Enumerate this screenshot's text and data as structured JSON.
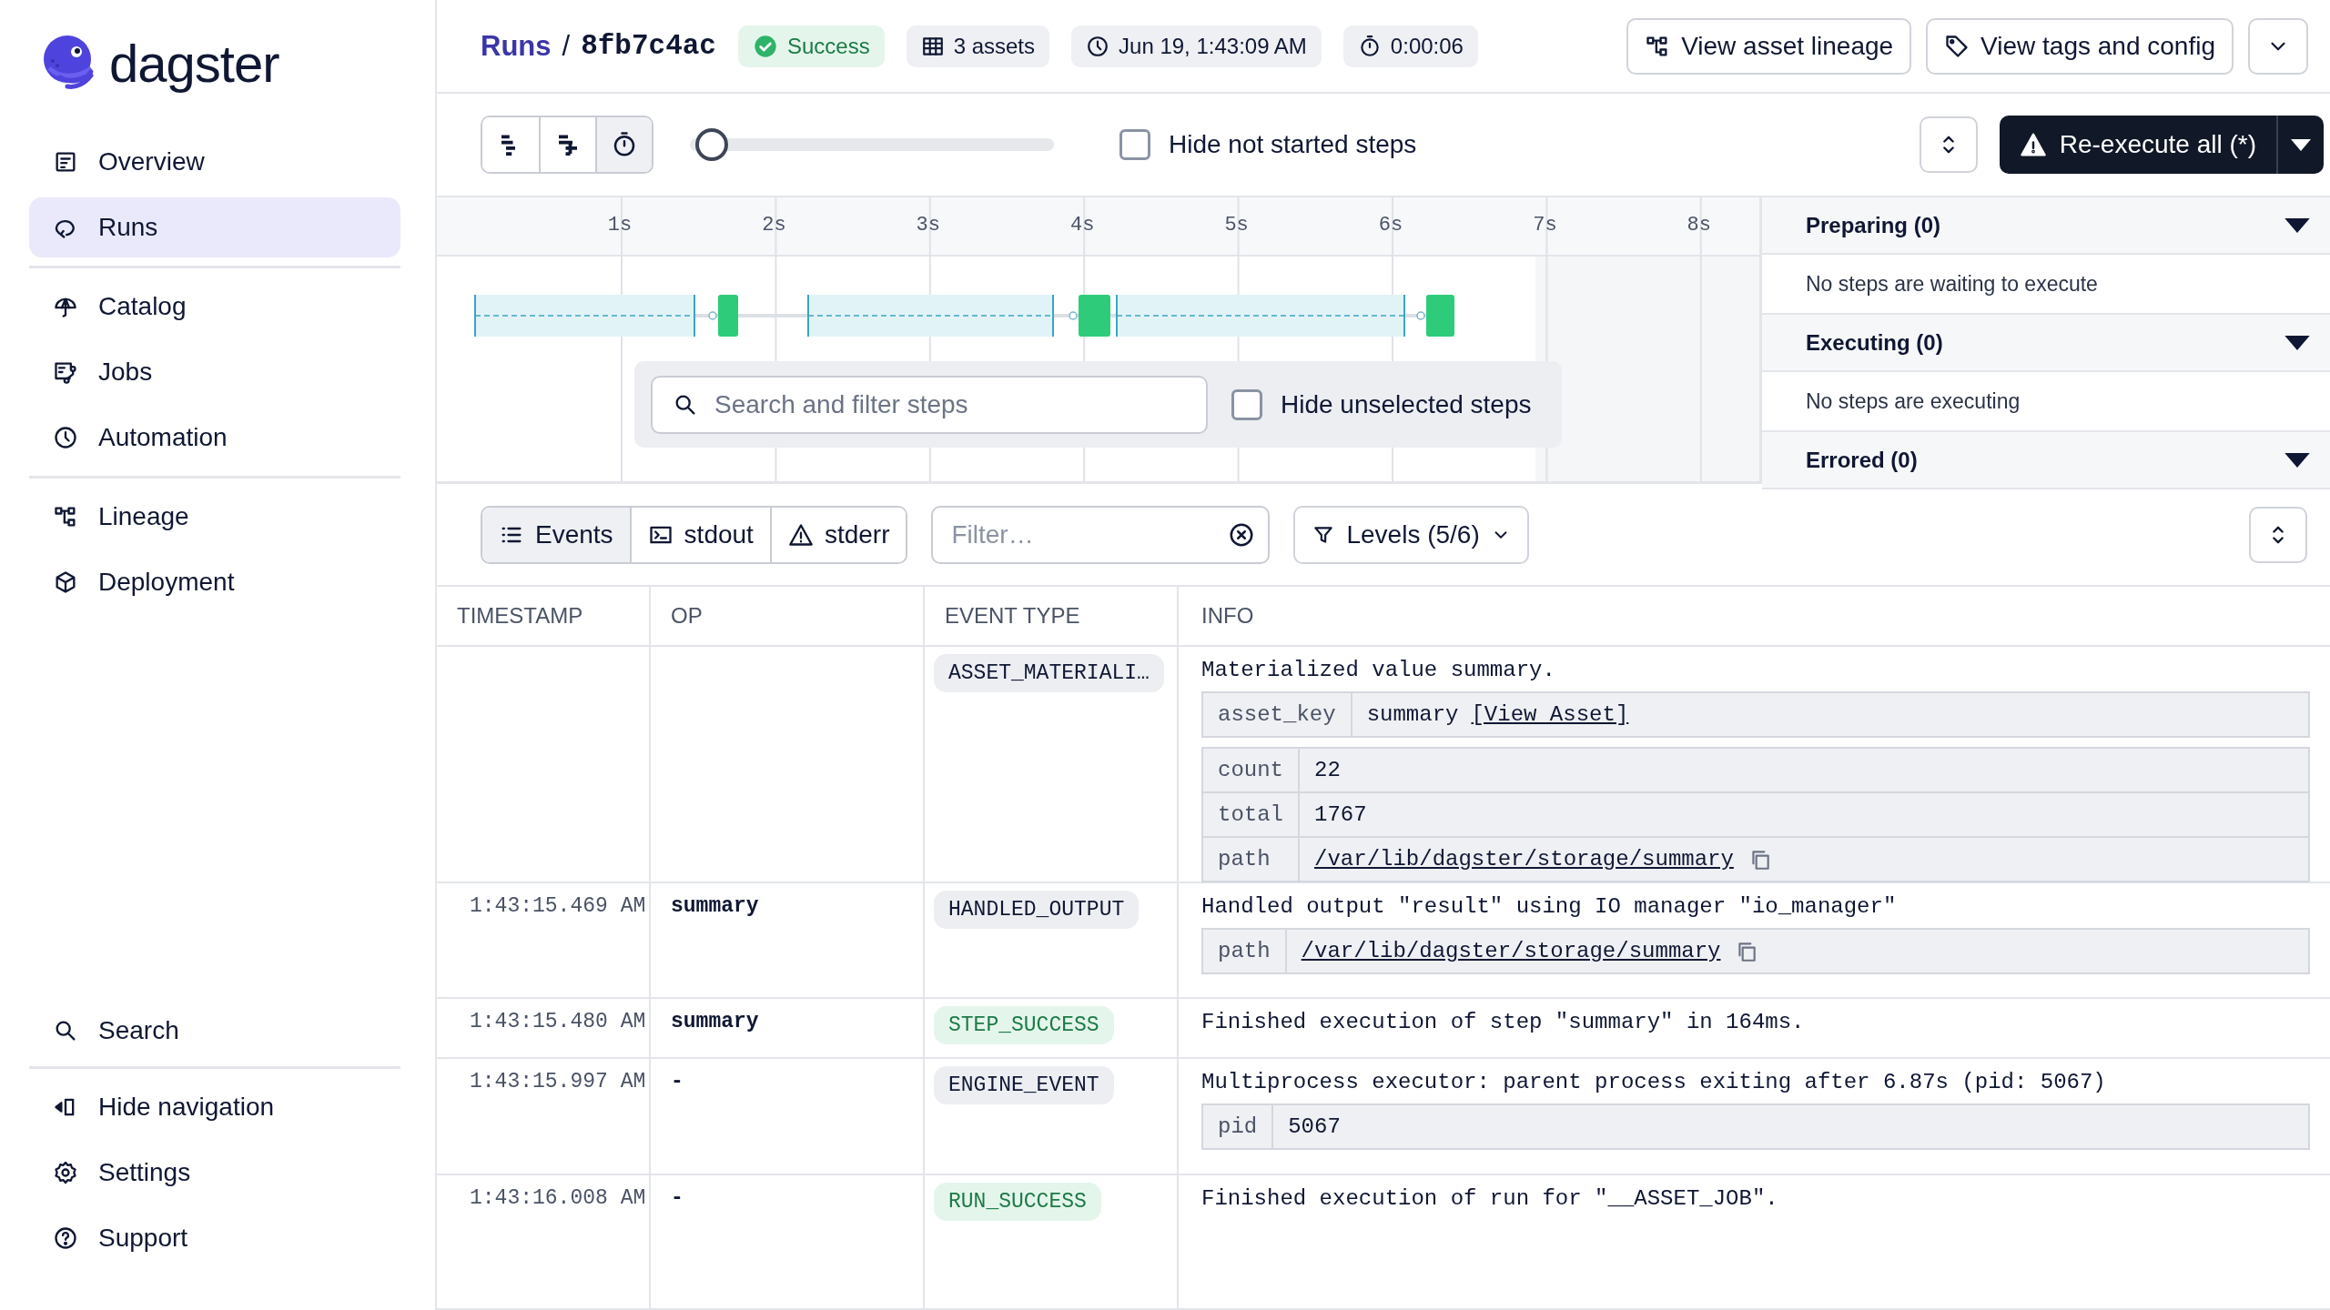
{
  "sidebar": {
    "logo": "dagster",
    "nav_groups": [
      [
        {
          "label": "Overview",
          "selected": false
        },
        {
          "label": "Runs",
          "selected": true
        }
      ],
      [
        {
          "label": "Catalog",
          "selected": false
        },
        {
          "label": "Jobs",
          "selected": false
        },
        {
          "label": "Automation",
          "selected": false
        }
      ],
      [
        {
          "label": "Lineage",
          "selected": false
        },
        {
          "label": "Deployment",
          "selected": false
        }
      ]
    ],
    "footer_groups": [
      [
        {
          "label": "Search"
        }
      ],
      [
        {
          "label": "Hide navigation"
        },
        {
          "label": "Settings"
        },
        {
          "label": "Support"
        }
      ]
    ]
  },
  "header": {
    "breadcrumb": {
      "parent": "Runs",
      "separator": "/",
      "run_id": "8fb7c4ac"
    },
    "status": {
      "label": "Success",
      "kind": "success"
    },
    "tags": [
      "3 assets",
      "Jun 19, 1:43:09 AM",
      "0:00:06"
    ],
    "buttons": [
      "View asset lineage",
      "View tags and config"
    ]
  },
  "toolbar": {
    "view_modes": [
      {
        "selected": false
      },
      {
        "selected": false
      },
      {
        "selected": true
      }
    ],
    "zoom_slider": {
      "level": 0.03
    },
    "hide_not_started": {
      "label": "Hide not started steps",
      "checked": false
    },
    "reexecute": {
      "label": "Re-execute all (*)"
    }
  },
  "timeline": {
    "axis_ticks": [
      "1s",
      "2s",
      "3s",
      "4s",
      "5s",
      "6s",
      "7s",
      "8s"
    ],
    "step_search": {
      "placeholder": "Search and filter steps"
    },
    "hide_unselected": {
      "label": "Hide unselected steps",
      "checked": false
    }
  },
  "status_panel": {
    "sections": [
      {
        "title": "Preparing (0)",
        "message": "No steps are waiting to execute"
      },
      {
        "title": "Executing (0)",
        "message": "No steps are executing"
      },
      {
        "title": "Errored (0)"
      }
    ]
  },
  "logs": {
    "tabs": [
      {
        "label": "Events",
        "selected": true
      },
      {
        "label": "stdout",
        "selected": false
      },
      {
        "label": "stderr",
        "selected": false
      }
    ],
    "filter": {
      "placeholder": "Filter…"
    },
    "levels": {
      "label": "Levels (5/6)"
    },
    "table": {
      "columns": [
        "TIMESTAMP",
        "OP",
        "EVENT TYPE",
        "INFO"
      ],
      "rows": [
        {
          "event_type": "ASSET_MATERIALI…",
          "kind": "neutral",
          "message": "Materialized value summary.",
          "metadata": [
            [
              {
                "key": "asset_key",
                "value": "summary",
                "link": "[View Asset]",
                "kind": "asset"
              }
            ],
            [
              {
                "key": "count",
                "value": "22",
                "kind": "text"
              },
              {
                "key": "total",
                "value": "1767",
                "kind": "text"
              },
              {
                "key": "path",
                "value": "/var/lib/dagster/storage/summary",
                "kind": "path"
              }
            ]
          ]
        },
        {
          "timestamp": "1:43:15.469 AM",
          "op": "summary",
          "event_type": "HANDLED_OUTPUT",
          "kind": "neutral",
          "message": "Handled output \"result\" using IO manager \"io_manager\"",
          "metadata": [
            [
              {
                "key": "path",
                "value": "/var/lib/dagster/storage/summary",
                "kind": "path"
              }
            ]
          ]
        },
        {
          "timestamp": "1:43:15.480 AM",
          "op": "summary",
          "event_type": "STEP_SUCCESS",
          "kind": "success",
          "message": "Finished execution of step \"summary\" in 164ms."
        },
        {
          "timestamp": "1:43:15.997 AM",
          "op": "-",
          "event_type": "ENGINE_EVENT",
          "kind": "neutral",
          "message": "Multiprocess executor: parent process exiting after 6.87s (pid: 5067)",
          "metadata": [
            [
              {
                "key": "pid",
                "value": "5067",
                "kind": "text"
              }
            ]
          ]
        },
        {
          "timestamp": "1:43:16.008 AM",
          "op": "-",
          "event_type": "RUN_SUCCESS",
          "kind": "success",
          "message": "Finished execution of run for \"__ASSET_JOB\"."
        }
      ]
    }
  }
}
